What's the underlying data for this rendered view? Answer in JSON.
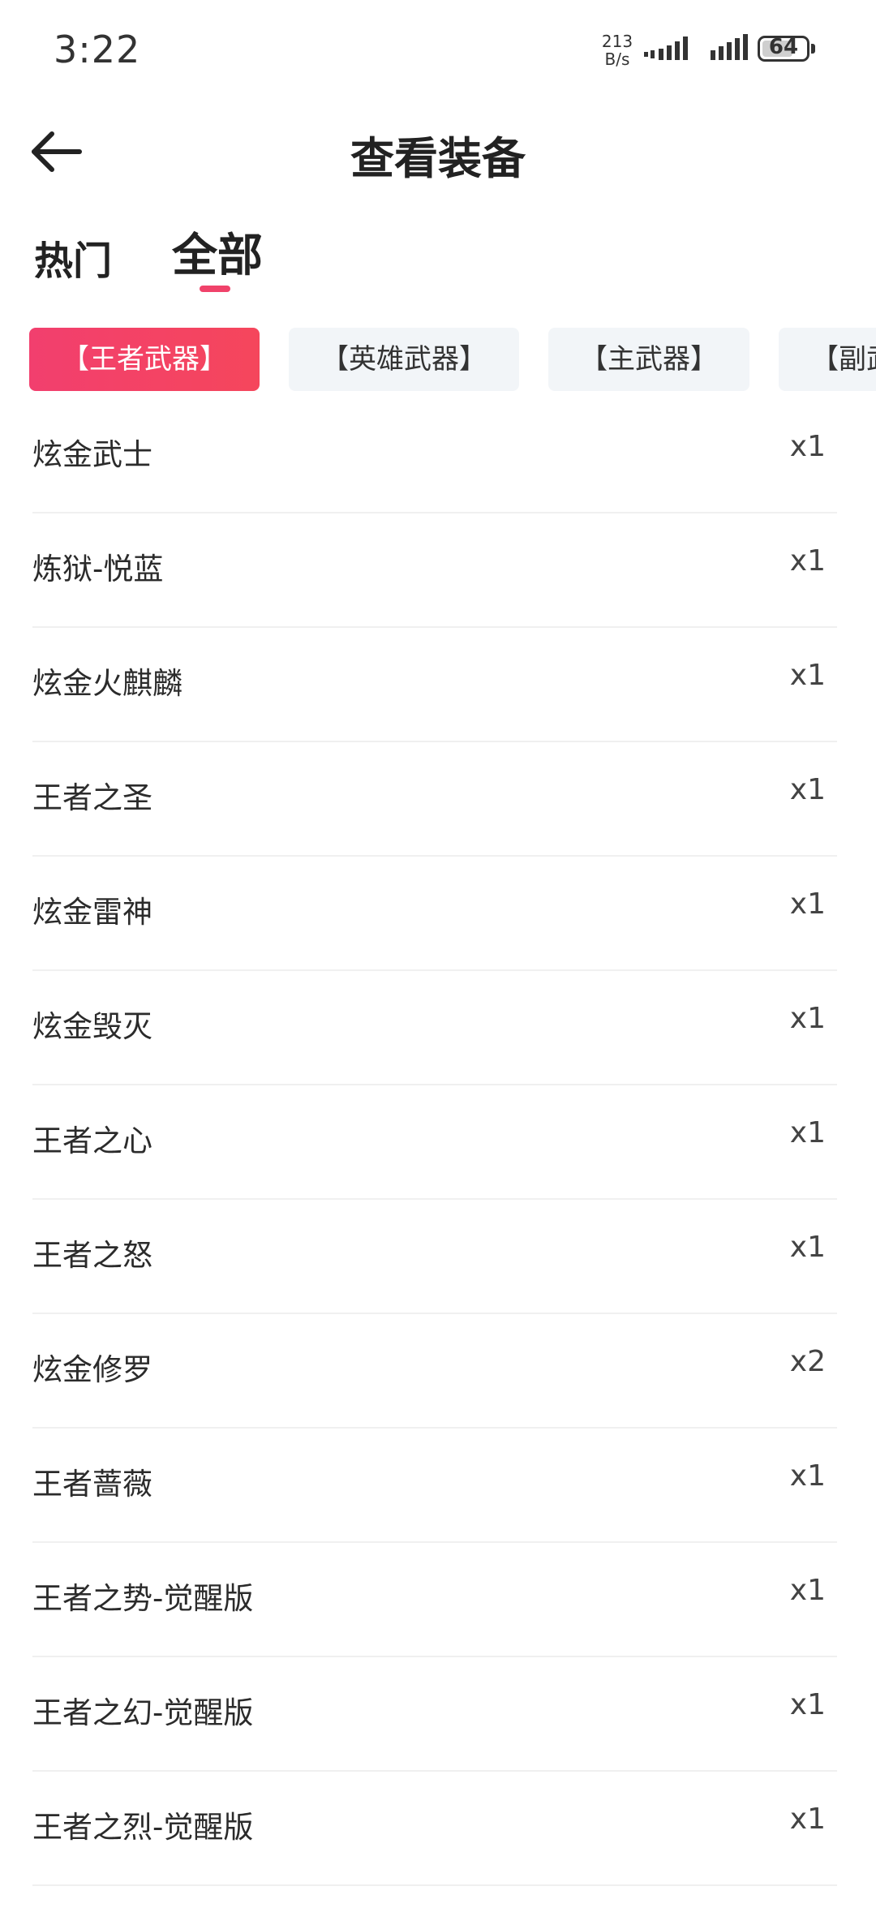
{
  "status_bar": {
    "time": "3:22",
    "net_speed_value": "213",
    "net_speed_unit": "B/s",
    "battery_level": "64"
  },
  "header": {
    "back_icon": "arrow-left-icon",
    "title": "查看装备"
  },
  "tabs": [
    {
      "label": "热门",
      "active": false
    },
    {
      "label": "全部",
      "active": true
    }
  ],
  "colors": {
    "accent": "#f0426a",
    "chip_bg": "#f2f5f8",
    "divider": "#f0f0f0"
  },
  "categories": [
    {
      "label": "【王者武器】",
      "active": true
    },
    {
      "label": "【英雄武器】",
      "active": false
    },
    {
      "label": "【主武器】",
      "active": false
    },
    {
      "label": "【副武器】",
      "active": false
    }
  ],
  "items": [
    {
      "name": "炫金武士",
      "count": "x1"
    },
    {
      "name": "炼狱-悦蓝",
      "count": "x1"
    },
    {
      "name": "炫金火麒麟",
      "count": "x1"
    },
    {
      "name": "王者之圣",
      "count": "x1"
    },
    {
      "name": "炫金雷神",
      "count": "x1"
    },
    {
      "name": "炫金毁灭",
      "count": "x1"
    },
    {
      "name": "王者之心",
      "count": "x1"
    },
    {
      "name": "王者之怒",
      "count": "x1"
    },
    {
      "name": "炫金修罗",
      "count": "x2"
    },
    {
      "name": "王者蔷薇",
      "count": "x1"
    },
    {
      "name": "王者之势-觉醒版",
      "count": "x1"
    },
    {
      "name": "王者之幻-觉醒版",
      "count": "x1"
    },
    {
      "name": "王者之烈-觉醒版",
      "count": "x1"
    }
  ]
}
